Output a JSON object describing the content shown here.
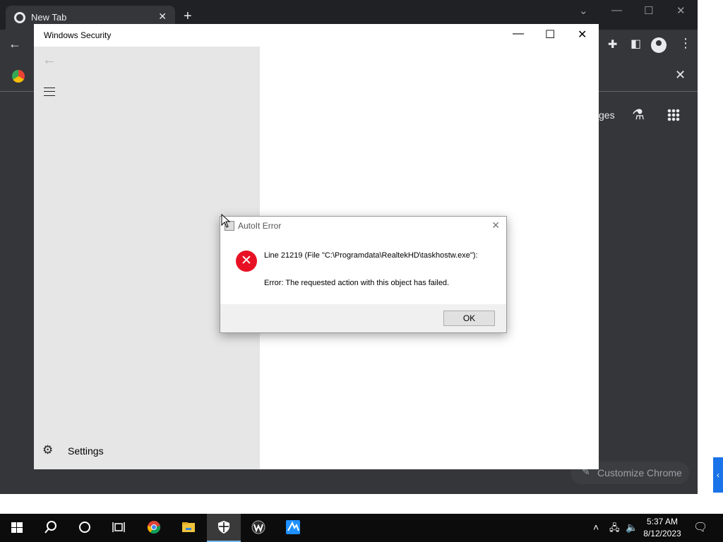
{
  "chrome": {
    "tab_title": "New Tab",
    "tab_close": "✕",
    "new_tab": "+",
    "ntp_link_partial": "ges",
    "customize_label": "Customize Chrome",
    "panel_close": "✕"
  },
  "windows_security": {
    "title": "Windows Security",
    "minimize": "—",
    "maximize": "☐",
    "close": "✕",
    "back": "←",
    "settings_label": "Settings"
  },
  "dialog": {
    "title": "AutoIt Error",
    "close": "✕",
    "line1": "Line 21219  (File \"C:\\Programdata\\RealtekHD\\taskhostw.exe\"):",
    "line2": "Error: The requested action with this object has failed.",
    "ok_label": "OK",
    "icon": "error-icon"
  },
  "taskbar": {
    "time": "5:37 AM",
    "date": "8/12/2023",
    "items": [
      "start",
      "search",
      "cortana",
      "task-view",
      "chrome",
      "file-explorer",
      "windows-security",
      "app-w",
      "app-blue"
    ]
  },
  "colors": {
    "chrome_bg": "#35363a",
    "nav_bg": "#e6e6e6",
    "error_red": "#e81123",
    "taskbar": "#0c0c0c"
  }
}
